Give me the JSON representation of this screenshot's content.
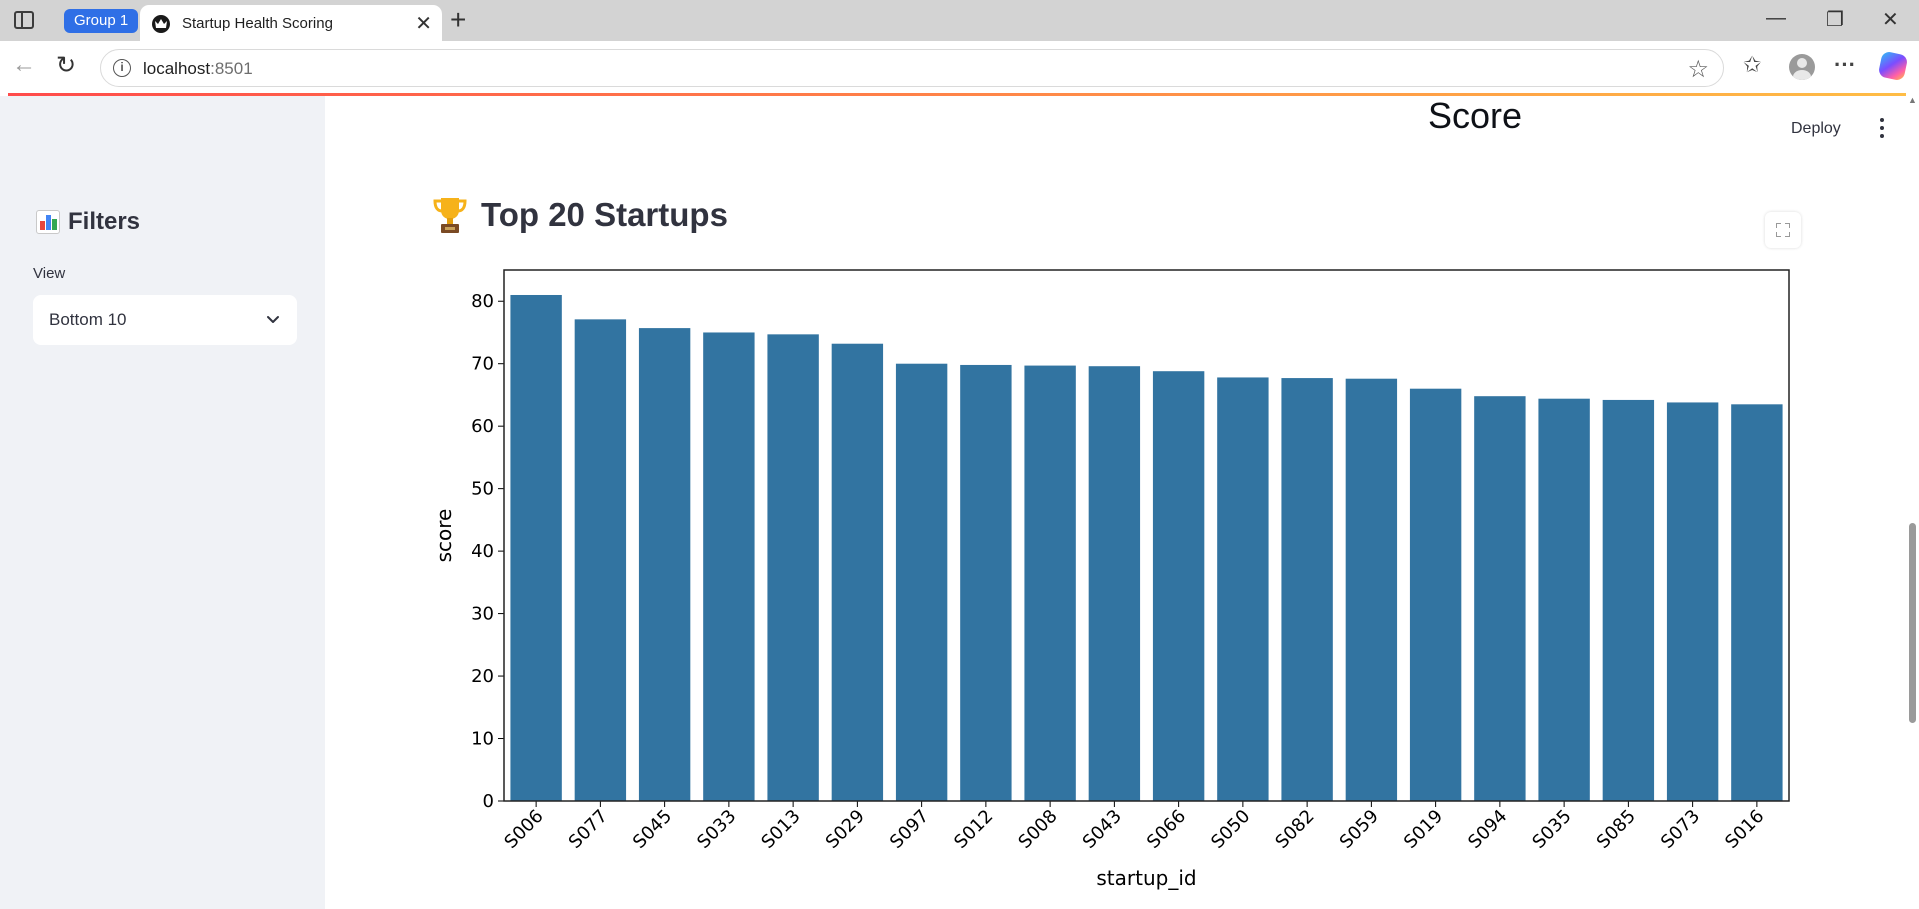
{
  "browser": {
    "tab_group": "Group 1",
    "tab_title": "Startup Health Scoring",
    "url_host": "localhost",
    "url_port": ":8501"
  },
  "sidebar": {
    "header": "Filters",
    "view_label": "View",
    "view_selected": "Bottom 10"
  },
  "main": {
    "title": "Score",
    "deploy_label": "Deploy",
    "section_header": "Top 20 Startups"
  },
  "colors": {
    "bar": "#3274a1",
    "sidebar_bg": "#f0f2f6",
    "group_chip": "#2f6fe6"
  },
  "chart_data": {
    "type": "bar",
    "categories": [
      "S006",
      "S077",
      "S045",
      "S033",
      "S013",
      "S029",
      "S097",
      "S012",
      "S008",
      "S043",
      "S066",
      "S050",
      "S082",
      "S059",
      "S019",
      "S094",
      "S035",
      "S085",
      "S073",
      "S016"
    ],
    "values": [
      81.0,
      77.1,
      75.7,
      75.0,
      74.7,
      73.2,
      70.0,
      69.8,
      69.7,
      69.6,
      68.8,
      67.8,
      67.7,
      67.6,
      66.0,
      64.8,
      64.4,
      64.2,
      63.8,
      63.5
    ],
    "xlabel": "startup_id",
    "ylabel": "score",
    "ylim": [
      0,
      85
    ],
    "yticks": [
      0,
      10,
      20,
      30,
      40,
      50,
      60,
      70,
      80
    ],
    "grid": false
  }
}
